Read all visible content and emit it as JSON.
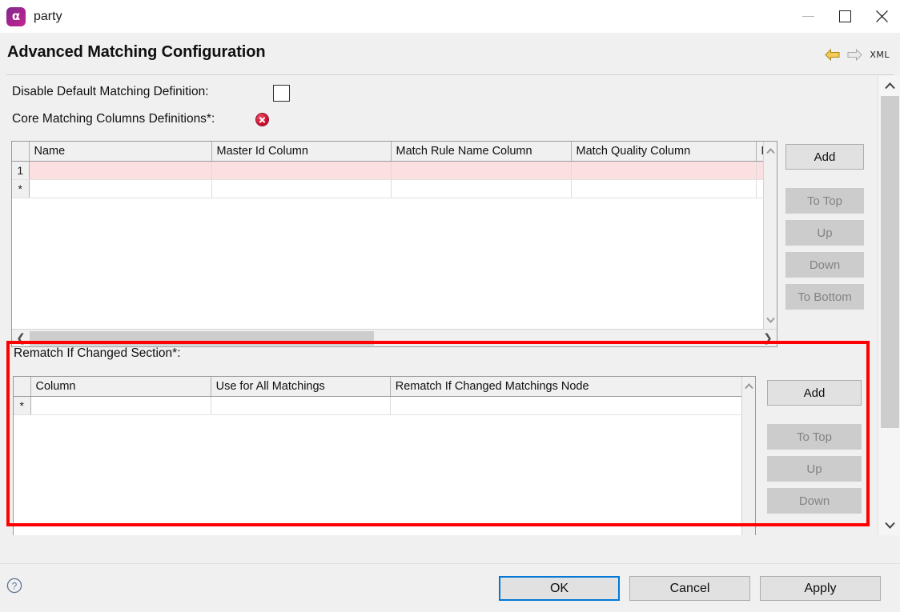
{
  "window": {
    "title": "party",
    "icon": "app-alpha-icon",
    "icon_glyph": "α",
    "controls": {
      "minimize": "minimize-icon",
      "maximize": "maximize-icon",
      "close": "close-icon"
    }
  },
  "header": {
    "title": "Advanced Matching Configuration",
    "back_arrow": "back-arrow-icon",
    "forward_arrow": "forward-arrow-icon",
    "xml_label": "XML"
  },
  "form": {
    "disable_default_label": "Disable Default Matching Definition:",
    "disable_default_checked": false,
    "core_columns_label": "Core Matching Columns Definitions*:",
    "core_columns_error": "error-badge-icon"
  },
  "core_table": {
    "headers": [
      "Name",
      "Master Id Column",
      "Match Rule Name Column",
      "Match Quality Column",
      "M"
    ],
    "rows": [
      {
        "row_header": "1",
        "error": true,
        "cells": [
          "",
          "",
          "",
          "",
          ""
        ]
      },
      {
        "row_header": "*",
        "error": false,
        "cells": [
          "",
          "",
          "",
          "",
          ""
        ]
      }
    ],
    "scroll_up": "scroll-up-icon",
    "scroll_down": "scroll-down-icon",
    "hscroll_left": "scroll-left-icon",
    "hscroll_right": "scroll-right-icon"
  },
  "core_buttons": [
    {
      "label": "Add",
      "enabled": true
    },
    {
      "label": "To Top",
      "enabled": false
    },
    {
      "label": "Up",
      "enabled": false
    },
    {
      "label": "Down",
      "enabled": false
    },
    {
      "label": "To Bottom",
      "enabled": false
    }
  ],
  "rematch_section": {
    "label": "Rematch If Changed Section*:",
    "highlight_color": "#ff0000"
  },
  "rematch_table": {
    "headers": [
      "Column",
      "Use for All Matchings",
      "Rematch If Changed Matchings Node"
    ],
    "rows": [
      {
        "row_header": "*",
        "cells": [
          "",
          "",
          ""
        ]
      }
    ],
    "scroll_up": "scroll-up-icon"
  },
  "rematch_buttons": [
    {
      "label": "Add",
      "enabled": true
    },
    {
      "label": "To Top",
      "enabled": false
    },
    {
      "label": "Up",
      "enabled": false
    },
    {
      "label": "Down",
      "enabled": false
    }
  ],
  "main_scrollbar": {
    "up": "scroll-up-icon",
    "down": "scroll-down-icon"
  },
  "footer": {
    "help": "help-icon",
    "ok": "OK",
    "cancel": "Cancel",
    "apply": "Apply"
  },
  "colors": {
    "accent": "#0078d7",
    "error_row": "#fcdfe0",
    "highlight": "#ff0000",
    "brand_start": "#7b2d8e",
    "brand_end": "#c2268d"
  }
}
